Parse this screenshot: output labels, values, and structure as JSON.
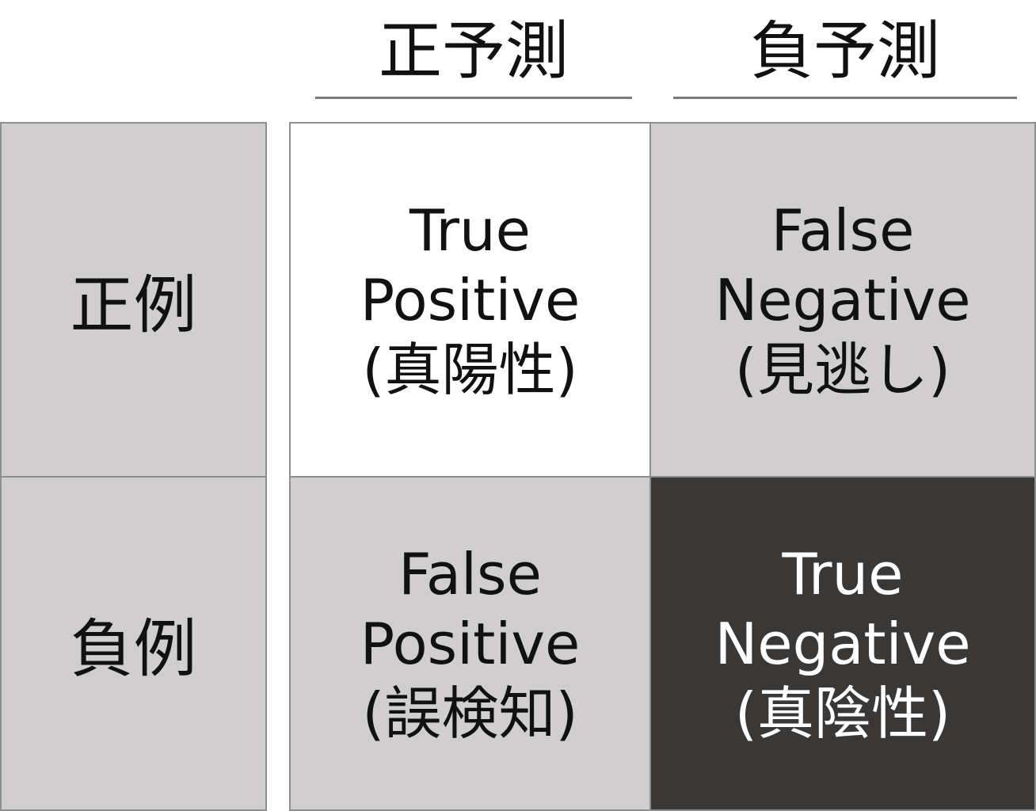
{
  "column_headers": [
    {
      "label": "正予測"
    },
    {
      "label": "負予測"
    }
  ],
  "row_headers": [
    {
      "label": "正例"
    },
    {
      "label": "負例"
    }
  ],
  "cells": {
    "tp": {
      "line1": "True",
      "line2": "Positive",
      "line3": "(真陽性)"
    },
    "fn": {
      "line1": "False",
      "line2": "Negative",
      "line3": "(見逃し)"
    },
    "fp": {
      "line1": "False",
      "line2": "Positive",
      "line3": "(誤検知)"
    },
    "tn": {
      "line1": "True",
      "line2": "Negative",
      "line3": "(真陰性)"
    }
  },
  "colors": {
    "row_header_bg": "#d0cecf",
    "tp_bg": "#ffffff",
    "fn_bg": "#d0cecf",
    "fp_bg": "#d0cecf",
    "tn_bg": "#3a3837",
    "tn_text": "#ffffff",
    "text": "#111111",
    "border": "#8e8e8e"
  }
}
